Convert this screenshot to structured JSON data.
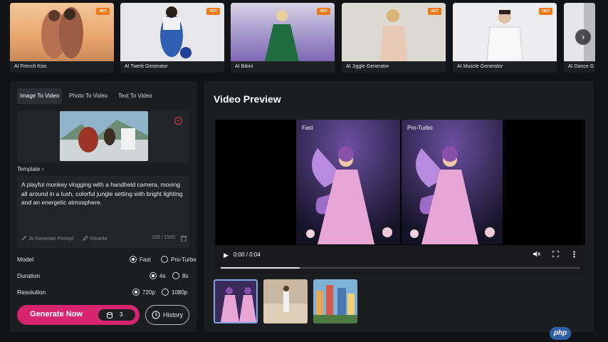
{
  "templates": [
    {
      "label": "AI French Kiss",
      "hot": "HOT"
    },
    {
      "label": "AI Twerk Generator",
      "hot": "HOT"
    },
    {
      "label": "AI Bikini",
      "hot": "HOT"
    },
    {
      "label": "AI Jiggle Generator",
      "hot": "HOT"
    },
    {
      "label": "AI Muscle Generator",
      "hot": "HOT"
    },
    {
      "label": "AI Dance G"
    }
  ],
  "carousel_next": "›",
  "tabs": [
    "Image To Video",
    "Photo To Video",
    "Text To Video"
  ],
  "template_link": "Template ›",
  "close_icon": "×",
  "prompt": {
    "text": "A playful monkey vlogging with a handheld camera, moving all around in a lush, colorful jungle setting with bright lighting and an energetic atmosphere.",
    "generate_prompt": "AI Generate Prompt",
    "rewrite": "Rewrite",
    "char_count": "152 / 1500"
  },
  "settings": {
    "model": {
      "label": "Model",
      "options": [
        "Fast",
        "Pro-Turbo"
      ],
      "selected": "Fast"
    },
    "duration": {
      "label": "Duration",
      "options": [
        "4s",
        "8s"
      ],
      "selected": "4s"
    },
    "resolution": {
      "label": "Resolution",
      "options": [
        "720p",
        "1080p"
      ],
      "selected": "720p"
    }
  },
  "generate": {
    "label": "Generate Now",
    "credits": "3"
  },
  "history": {
    "label": "History"
  },
  "preview": {
    "title": "Video Preview",
    "frames": [
      "Fast",
      "Pro-Turbo"
    ],
    "time": "0:00 / 0:04",
    "play": "▶",
    "progress": 0.22
  },
  "watermark": "php",
  "colors": {
    "accent": "#d6246e",
    "hot_badge": "#f07a18",
    "selected_border": "#7fa6e6"
  }
}
